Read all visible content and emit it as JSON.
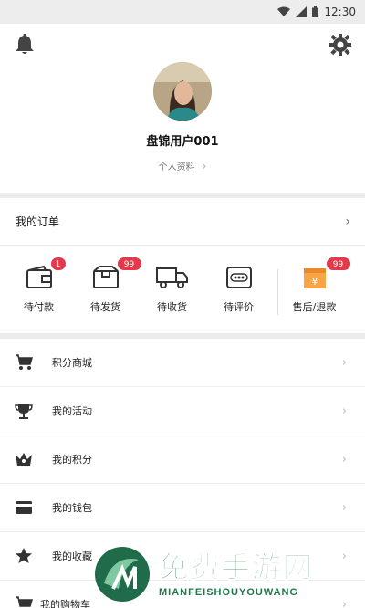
{
  "status_bar": {
    "time": "12:30"
  },
  "profile": {
    "username": "盘锦用户001",
    "profile_link": "个人资料",
    "chevron": "›"
  },
  "orders": {
    "title": "我的订单",
    "chevron": "›",
    "items": [
      {
        "label": "待付款",
        "badge": "1",
        "icon": "wallet-icon"
      },
      {
        "label": "待发货",
        "badge": "99",
        "icon": "package-icon"
      },
      {
        "label": "待收货",
        "badge": "",
        "icon": "truck-icon"
      },
      {
        "label": "待评价",
        "badge": "",
        "icon": "comment-icon"
      },
      {
        "label": "售后/退款",
        "badge": "99",
        "icon": "refund-icon"
      }
    ]
  },
  "menu": {
    "items": [
      {
        "label": "积分商城",
        "icon": "cart-icon"
      },
      {
        "label": "我的活动",
        "icon": "trophy-icon"
      },
      {
        "label": "我的积分",
        "icon": "crown-icon"
      },
      {
        "label": "我的钱包",
        "icon": "card-icon"
      },
      {
        "label": "我的收藏",
        "icon": "star-icon"
      },
      {
        "label": "我的购物车",
        "icon": "cart-icon"
      }
    ],
    "chevron": "›"
  },
  "watermark": {
    "title": "免费手游网",
    "subtitle": "MIANFEISHOUYOUWANG"
  },
  "colors": {
    "badge": "#e23a4a",
    "accent_orange": "#f39a3c",
    "watermark_green": "#1e7a4d"
  }
}
